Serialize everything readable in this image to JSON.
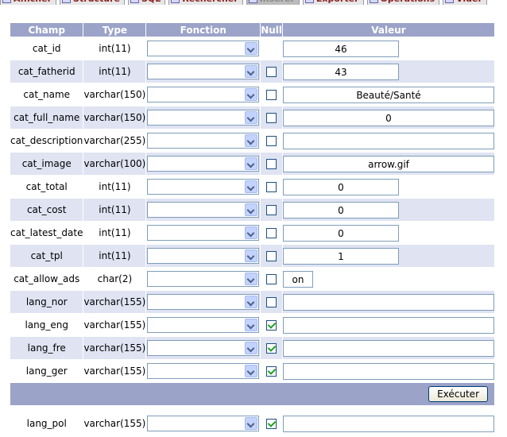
{
  "tabs": [
    {
      "label": "Afficher",
      "icon": "table-icon"
    },
    {
      "label": "Structure",
      "icon": "structure-icon"
    },
    {
      "label": "SQL",
      "icon": "sql-icon"
    },
    {
      "label": "Rechercher",
      "icon": "search-icon"
    },
    {
      "label": "Insérer",
      "icon": "insert-icon",
      "active": true
    },
    {
      "label": "Exporter",
      "icon": "export-icon"
    },
    {
      "label": "Opérations",
      "icon": "operations-icon"
    },
    {
      "label": "Vider",
      "icon": "empty-icon"
    }
  ],
  "headers": {
    "champ": "Champ",
    "type": "Type",
    "fonction": "Fonction",
    "null": "Null",
    "valeur": "Valeur"
  },
  "rows": [
    {
      "champ": "cat_id",
      "type": "int(11)",
      "null": "none",
      "value": "46",
      "width": "s"
    },
    {
      "champ": "cat_fatherid",
      "type": "int(11)",
      "null": "unchecked",
      "value": "43",
      "width": "s"
    },
    {
      "champ": "cat_name",
      "type": "varchar(150)",
      "null": "unchecked",
      "value": "Beauté/Santé",
      "width": "l"
    },
    {
      "champ": "cat_full_name",
      "type": "varchar(150)",
      "null": "unchecked",
      "value": "0",
      "width": "l"
    },
    {
      "champ": "cat_description",
      "type": "varchar(255)",
      "null": "unchecked",
      "value": "",
      "width": "l"
    },
    {
      "champ": "cat_image",
      "type": "varchar(100)",
      "null": "unchecked",
      "value": "arrow.gif",
      "width": "l"
    },
    {
      "champ": "cat_total",
      "type": "int(11)",
      "null": "unchecked",
      "value": "0",
      "width": "s"
    },
    {
      "champ": "cat_cost",
      "type": "int(11)",
      "null": "unchecked",
      "value": "0",
      "width": "s"
    },
    {
      "champ": "cat_latest_date",
      "type": "int(11)",
      "null": "unchecked",
      "value": "0",
      "width": "s"
    },
    {
      "champ": "cat_tpl",
      "type": "int(11)",
      "null": "unchecked",
      "value": "1",
      "width": "s"
    },
    {
      "champ": "cat_allow_ads",
      "type": "char(2)",
      "null": "unchecked",
      "value": "on",
      "width": "xs"
    },
    {
      "champ": "lang_nor",
      "type": "varchar(155)",
      "null": "unchecked",
      "value": "",
      "width": "l"
    },
    {
      "champ": "lang_eng",
      "type": "varchar(155)",
      "null": "checked",
      "value": "",
      "width": "l"
    },
    {
      "champ": "lang_fre",
      "type": "varchar(155)",
      "null": "checked",
      "value": "",
      "width": "l"
    },
    {
      "champ": "lang_ger",
      "type": "varchar(155)",
      "null": "checked",
      "value": "",
      "width": "l"
    }
  ],
  "execute_label": "Exécuter",
  "after_rows": [
    {
      "champ": "lang_pol",
      "type": "varchar(155)",
      "null": "checked",
      "value": "",
      "width": "l"
    }
  ],
  "colors": {
    "header": "#9ba3c8",
    "alt_row": "#dfe3f2",
    "tab_text": "#8b2020"
  }
}
